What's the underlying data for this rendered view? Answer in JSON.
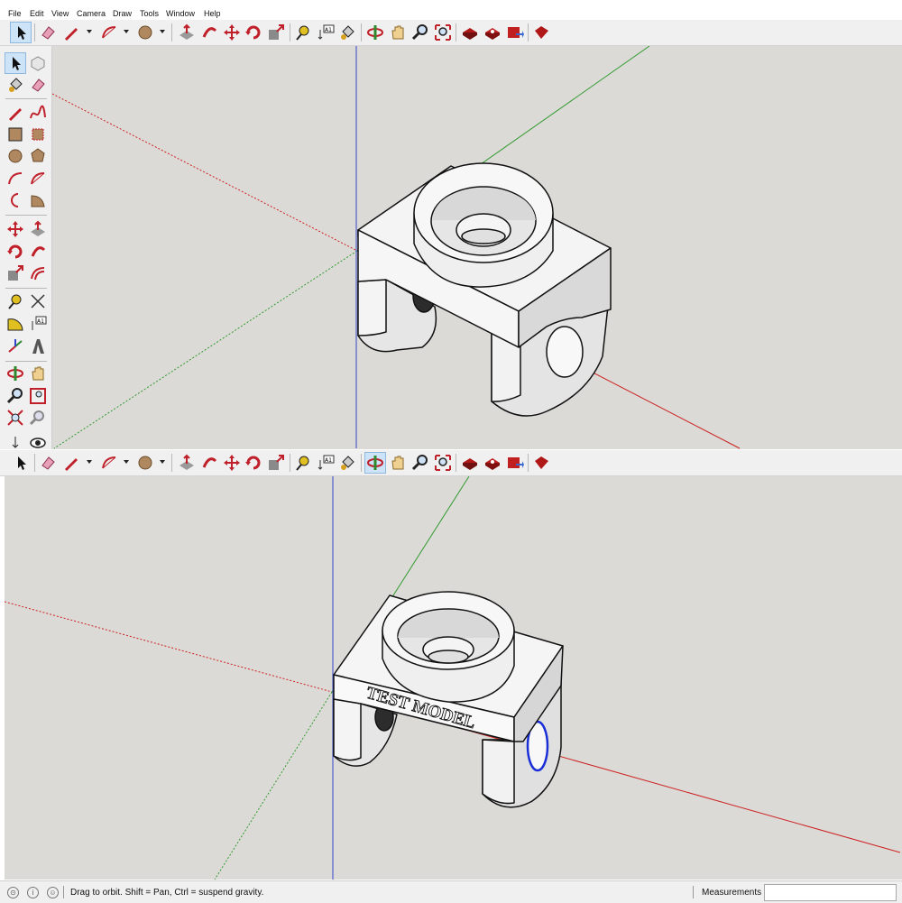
{
  "menu": [
    "File",
    "Edit",
    "View",
    "Camera",
    "Draw",
    "Tools",
    "Window",
    "Help"
  ],
  "toolbar": {
    "tools": [
      "select-icon",
      "eraser-icon",
      "pencil-icon",
      "arc-icon",
      "circle-icon",
      "push-pull-icon",
      "follow-me-icon",
      "move-icon",
      "rotate-icon",
      "scale-icon",
      "tape-measure-icon",
      "text-icon",
      "paint-bucket-icon",
      "orbit-icon",
      "pan-icon",
      "zoom-icon",
      "zoom-extents-icon",
      "warehouse-icon",
      "extension-warehouse-icon",
      "send-to-layout-icon",
      "extension-manager-icon"
    ]
  },
  "lower_toolbar": {
    "active_tool": "orbit-icon"
  },
  "model_label": "TEST MODEL",
  "status": {
    "hint": "Drag to orbit. Shift = Pan, Ctrl = suspend gravity.",
    "measurements_label": "Measurements",
    "measurements_value": ""
  },
  "colors": {
    "viewport_bg": "#dcdad6",
    "x_axis": "#cc2222",
    "y_axis": "#2f9a2f",
    "z_axis": "#3344cc",
    "selection": "#1a2fd6"
  }
}
